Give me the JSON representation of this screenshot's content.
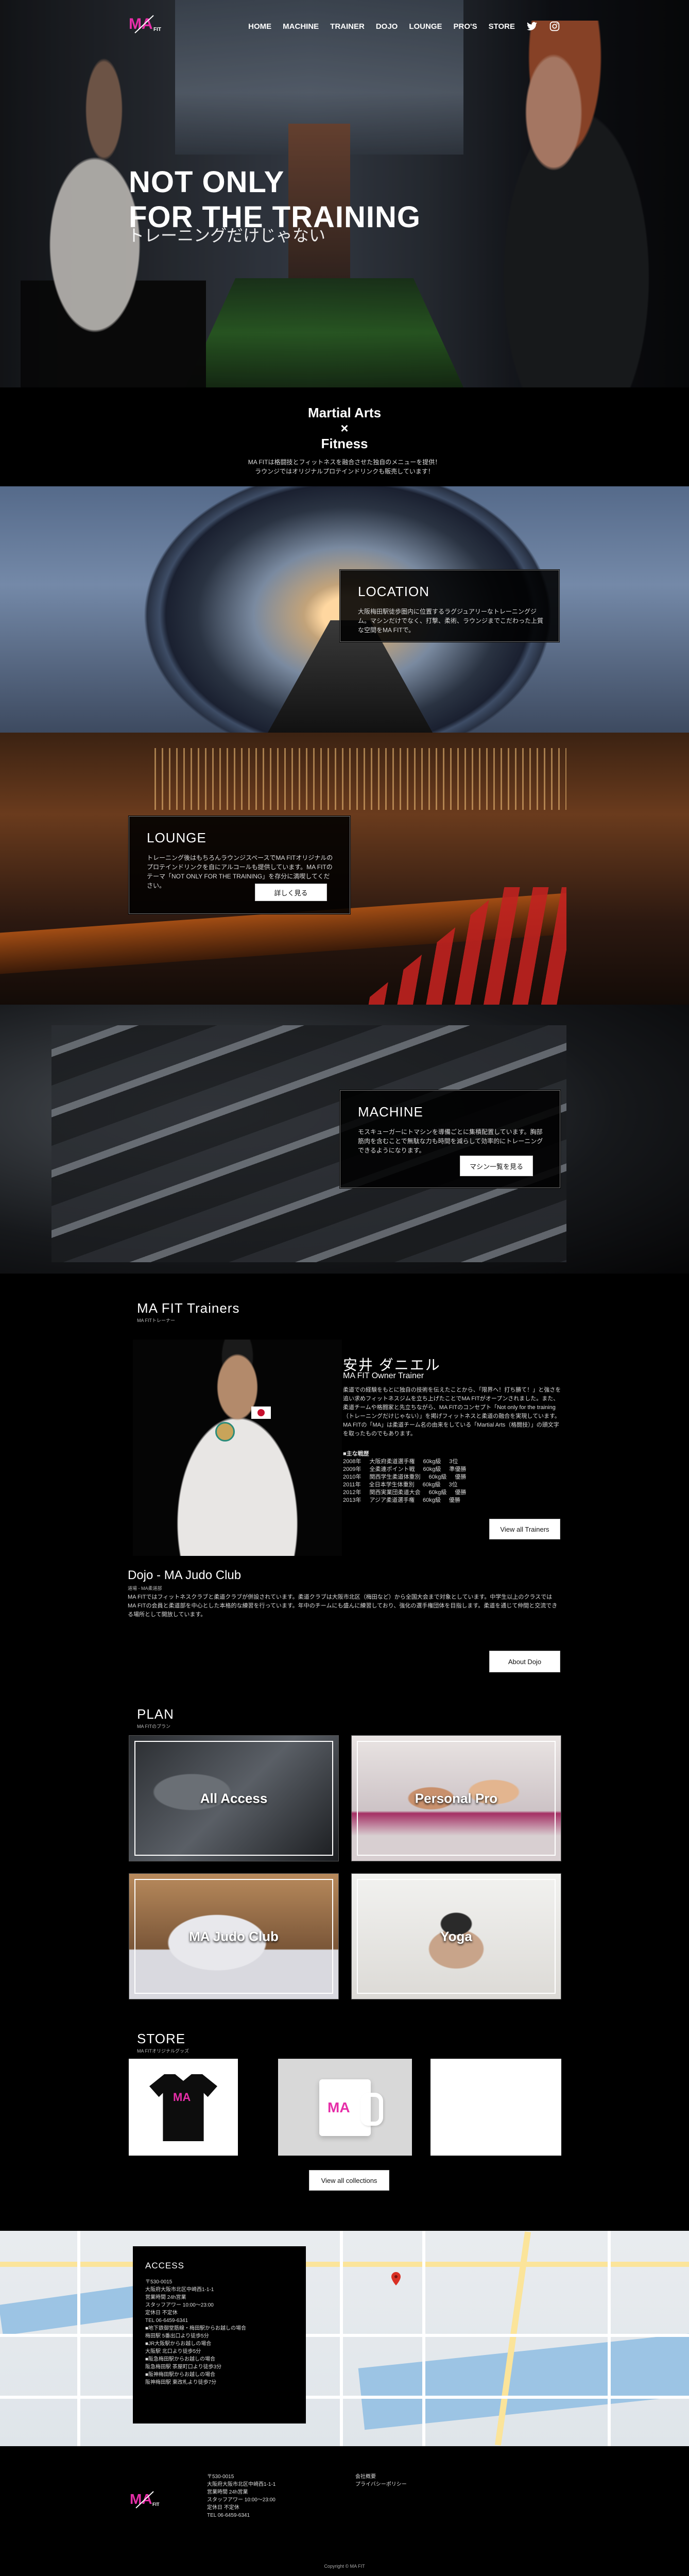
{
  "brand": {
    "logo_alt": "MA FIT",
    "logo_text": "MA",
    "logo_sub": "FIT",
    "accent": "#e62ea8",
    "accent2": "#ffffff"
  },
  "nav": {
    "items": [
      "HOME",
      "MACHINE",
      "TRAINER",
      "DOJO",
      "LOUNGE",
      "PRO'S",
      "STORE"
    ],
    "icons": [
      "twitter-icon",
      "instagram-icon"
    ]
  },
  "hero": {
    "title_line1": "NOT ONLY",
    "title_line2": "FOR THE TRAINING",
    "subtitle": "トレーニングだけじゃない"
  },
  "intro": {
    "title_line1": "Martial Arts",
    "title_line2": "×",
    "title_line3": "Fitness",
    "text_line1": "MA FITは格闘技とフィットネスを融合させた独自のメニューを提供！",
    "text_line2": "ラウンジではオリジナルプロテインドリンクも販売しています！"
  },
  "location": {
    "title": "LOCATION",
    "text": "大阪梅田駅徒歩圏内に位置するラグジュアリーなトレーニングジム。マシンだけでなく、打撃、柔術、ラウンジまでこだわった上質な空間をMA FITで。"
  },
  "lounge": {
    "title": "LOUNGE",
    "text": "トレーニング後はもちろんラウンジスペースでMA FITオリジナルのプロテインドリンクを自にアルコールも提供しています。MA FITのテーマ「NOT ONLY FOR THE TRAINING」を存分に満喫してください。",
    "button": "詳しく見る"
  },
  "machine": {
    "title": "MACHINE",
    "text": "モスキューガーにトマシンを導備ごとに集積配置しています。胸部筋肉を含むことで無駄な力も時間を減らして効率的にトレーニングできるようになります。",
    "button": "マシン一覧を見る"
  },
  "trainers": {
    "title": "MA FIT Trainers",
    "subtitle": "MA FITトレーナー",
    "name": "安井 ダニエル",
    "role": "MA FIT Owner Trainer",
    "bio": "柔道での経験をもとに独自の技術を伝えたことから、「限界へ！打ち勝て！」と強さを追い求めフィットネスジムを立ち上げたことでMA FITがオープンされました。また、柔道チームや格闘家と先立ちながら、MA FITのコンセプト「Not only for the training（トレーニングだけじゃない）」を掲げフィットネスと柔道の融合を実現しています。MA FITの「MA」は柔道チーム名の由来をしている「Martial Arts（格闘技）」の頭文字を取ったものでもあります。",
    "career_title": "■主な戦歴",
    "career": [
      [
        "2008年",
        "大阪府柔道選手権",
        "60kg級",
        "3位"
      ],
      [
        "2009年",
        "全柔連ポイント戦",
        "60kg級",
        "準優勝"
      ],
      [
        "2010年",
        "関西学生柔道体重別",
        "60kg級",
        "優勝"
      ],
      [
        "2011年",
        "全日本学生体重別",
        "60kg級",
        "3位"
      ],
      [
        "2012年",
        "関西実業団柔道大会",
        "60kg級",
        "優勝"
      ],
      [
        "2013年",
        "アジア柔道選手権",
        "60kg級",
        "優勝"
      ]
    ],
    "button": "View all Trainers"
  },
  "dojo": {
    "title": "Dojo - MA Judo Club",
    "subtitle": "道場 - MA柔道部",
    "text": "MA FITではフィットネスクラブと柔道クラブが併設されています。柔道クラブは大阪市北区（梅田など）から全国大会まで対象としています。中学生以上のクラスではMA FITの会員と柔道部を中心とした本格的な練習を行っています。年中のチームにも盛んに練習しており、強化の選手権団体を目指します。柔道を通じて仲間と交流できる場所として開放しています。",
    "button": "About Dojo"
  },
  "plan": {
    "title": "PLAN",
    "subtitle": "MA FITのプラン",
    "items": [
      "All Access",
      "Personal Pro",
      "MA Judo Club",
      "Yoga"
    ]
  },
  "store": {
    "title": "STORE",
    "subtitle": "MA FITオリジナルグッズ",
    "button": "View all collections"
  },
  "access": {
    "title": "ACCESS",
    "lines": [
      "〒530-0015",
      "大阪府大阪市北区中崎西1-1-1",
      "営業時間 24h営業",
      "スタッフアワー 10:00〜23:00",
      "定休日 不定休",
      "TEL 06-6459-6341",
      "■地下鉄御堂筋線・梅田駅からお越しの場合",
      "梅田駅 5番出口より徒歩5分",
      "■JR大阪駅からお越しの場合",
      "大阪駅 北口より徒歩5分",
      "■阪急梅田駅からお越しの場合",
      "阪急梅田駅 茶屋町口より徒歩3分",
      "■阪神梅田駅からお越しの場合",
      "阪神梅田駅 東改札より徒歩7分"
    ]
  },
  "footer": {
    "address": [
      "〒530-0015",
      "大阪府大阪市北区中崎西1-1-1",
      "営業時間 24h営業",
      "スタッフアワー 10:00〜23:00",
      "定休日 不定休",
      "TEL 06-6459-6341"
    ],
    "links": [
      "会社概要",
      "プライバシーポリシー"
    ],
    "copyright": "Copyright © MA FIT"
  }
}
